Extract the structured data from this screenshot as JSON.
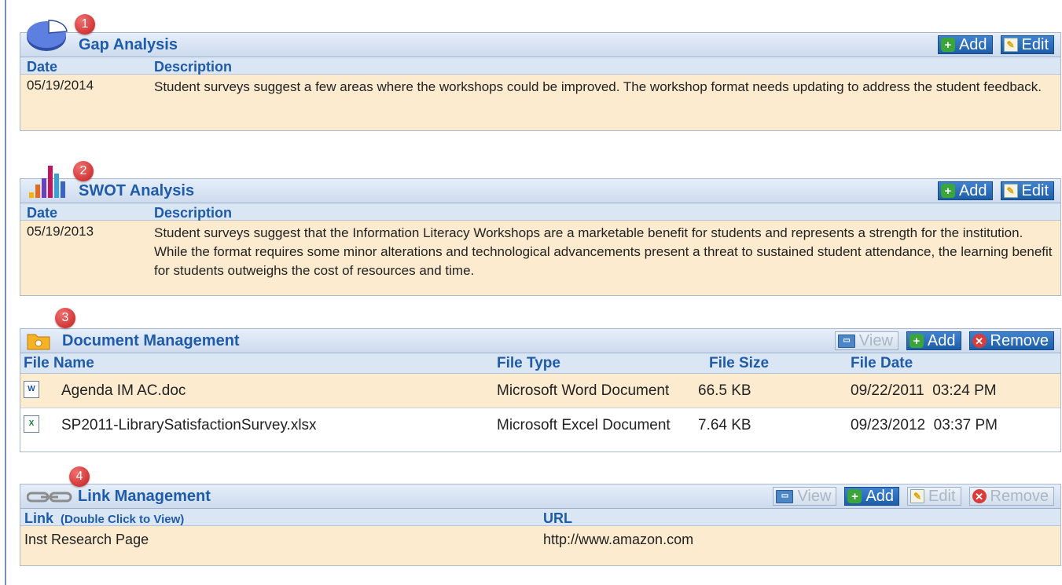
{
  "common": {
    "add_label": "Add",
    "edit_label": "Edit",
    "view_label": "View",
    "remove_label": "Remove",
    "date_header": "Date",
    "description_header": "Description"
  },
  "gap": {
    "badge": "1",
    "title": "Gap Analysis",
    "rows": [
      {
        "date": "05/19/2014",
        "description": "Student surveys suggest a few areas where the workshops could be improved. The workshop format needs updating to address the student feedback."
      }
    ]
  },
  "swot": {
    "badge": "2",
    "title": "SWOT Analysis",
    "rows": [
      {
        "date": "05/19/2013",
        "description": "Student surveys suggest that the Information Literacy Workshops are a marketable benefit for students and represents a strength for the institution. While the format requires some minor alterations and technological advancements present a threat to sustained student attendance, the learning benefit for students outweighs the cost of resources and time."
      }
    ]
  },
  "documents": {
    "badge": "3",
    "title": "Document Management",
    "columns": [
      "File Name",
      "File Type",
      "File Size",
      "File Date"
    ],
    "files": [
      {
        "icon": "word-doc-icon",
        "name": "Agenda IM AC.doc",
        "type": "Microsoft Word Document",
        "size": "66.5 KB",
        "date": "09/22/2011  03:24 PM"
      },
      {
        "icon": "excel-doc-icon",
        "name": "SP2011-LibrarySatisfactionSurvey.xlsx",
        "type": "Microsoft Excel Document",
        "size": "7.64 KB",
        "date": "09/23/2012  03:37 PM"
      }
    ]
  },
  "links": {
    "badge": "4",
    "title": "Link Management",
    "columns": [
      "Link",
      "(Double Click to View)",
      "URL"
    ],
    "rows": [
      {
        "link": "Inst Research Page",
        "url": "http://www.amazon.com"
      }
    ]
  },
  "colors": {
    "accent": "#1e5ba8",
    "row_bg": "#fcebcf",
    "button_blue": "#1d5ea8",
    "badge_red": "#c41f1f"
  }
}
